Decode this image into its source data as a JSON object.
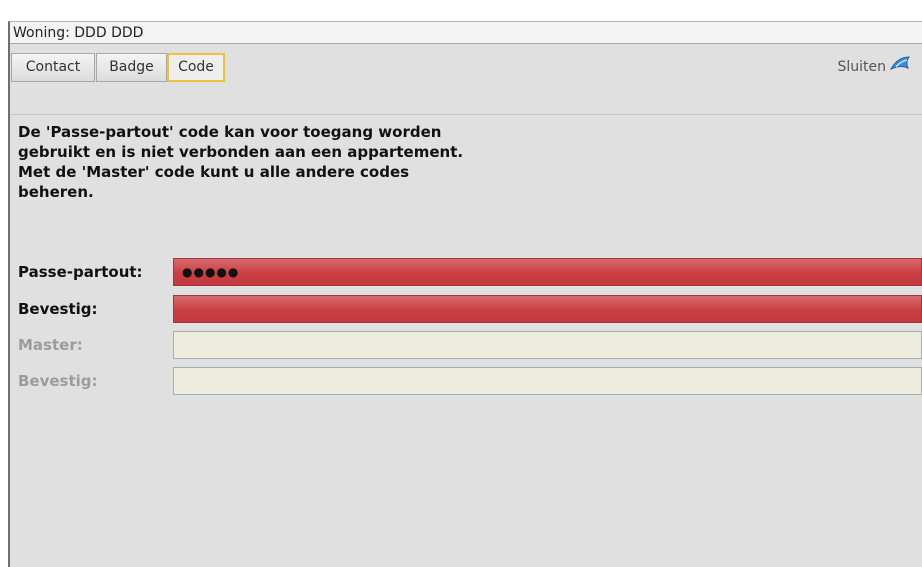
{
  "window": {
    "title": "Woning: DDD DDD"
  },
  "tabs": [
    {
      "label": "Contact",
      "active": false
    },
    {
      "label": "Badge",
      "active": false
    },
    {
      "label": "Code",
      "active": true
    }
  ],
  "close": {
    "label": "Sluiten",
    "icon": "shark-fin-icon"
  },
  "description": {
    "line1": "De 'Passe-partout' code kan voor toegang worden gebruikt en is niet verbonden aan een appartement.",
    "line2": "Met de 'Master' code kunt u alle andere codes beheren."
  },
  "form": {
    "passe_partout": {
      "label": "Passe-partout:",
      "value": "●●●●●",
      "state": "error",
      "enabled": true
    },
    "bevestig_1": {
      "label": "Bevestig:",
      "value": "",
      "state": "error",
      "enabled": true
    },
    "master": {
      "label": "Master:",
      "value": "",
      "state": "normal",
      "enabled": false
    },
    "bevestig_2": {
      "label": "Bevestig:",
      "value": "",
      "state": "normal",
      "enabled": false
    }
  },
  "colors": {
    "error_field": "#c93f44",
    "disabled_field": "#eeecdc",
    "active_tab_border": "#f0c23a",
    "close_icon": "#3b8fd8"
  }
}
